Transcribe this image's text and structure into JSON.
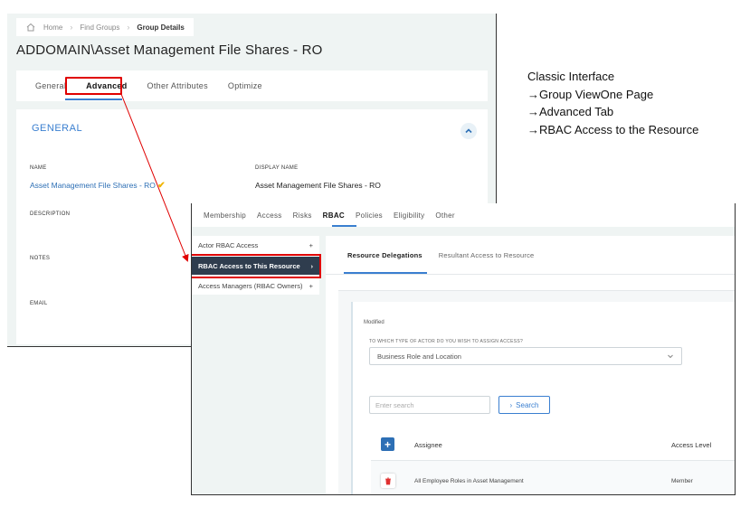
{
  "breadcrumb": {
    "items": [
      "Home",
      "Find Groups",
      "Group Details"
    ]
  },
  "page_title": "ADDOMAIN\\Asset Management File Shares - RO",
  "top_tabs": [
    "General",
    "Advanced",
    "Other Attributes",
    "Optimize"
  ],
  "general": {
    "title": "GENERAL",
    "name_label": "NAME",
    "name_value": "Asset Management File Shares - RO",
    "display_name_label": "DISPLAY NAME",
    "display_name_value": "Asset Management File Shares - RO",
    "description_label": "DESCRIPTION",
    "notes_label": "NOTES",
    "email_label": "EMAIL"
  },
  "front_tabs": [
    "Membership",
    "Access",
    "Risks",
    "RBAC",
    "Policies",
    "Eligibility",
    "Other"
  ],
  "left_menu": [
    {
      "label": "Actor RBAC Access",
      "icon": "+"
    },
    {
      "label": "RBAC Access to This Resource",
      "icon": "›"
    },
    {
      "label": "Access Managers (RBAC Owners)",
      "icon": "+"
    }
  ],
  "sub_tabs": [
    "Resource Delegations",
    "Resultant Access to Resource"
  ],
  "form": {
    "modified": "Modified",
    "select_label": "TO WHICH TYPE OF ACTOR DO YOU WISH TO ASSIGN ACCESS?",
    "select_value": "Business Role and Location",
    "search_placeholder": "Enter search",
    "search_button": "Search"
  },
  "table": {
    "headers": [
      "Assignee",
      "Access Level"
    ],
    "rows": [
      {
        "assignee": "All Employee Roles in Asset Management",
        "access_level": "Member"
      }
    ]
  },
  "annotation": [
    "Classic Interface",
    "→Group ViewOne Page",
    "→Advanced Tab",
    "→RBAC Access to the Resource"
  ],
  "colors": {
    "accent": "#3a7fd0",
    "highlight": "#e00000",
    "active_menu": "#2f3d4e"
  }
}
